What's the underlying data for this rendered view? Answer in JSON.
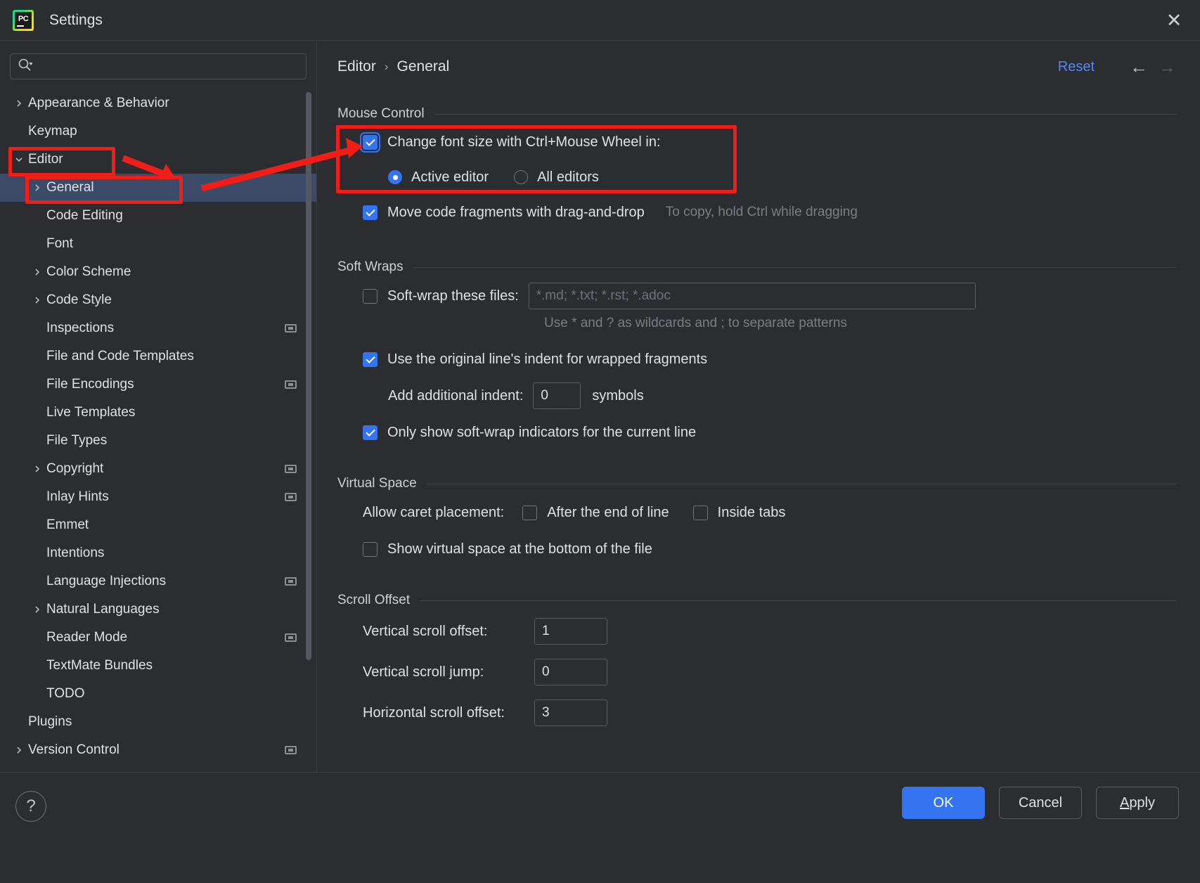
{
  "window": {
    "title": "Settings",
    "app_icon": "pycharm-icon",
    "close_icon": "close-icon"
  },
  "sidebar": {
    "search": {
      "placeholder": "",
      "value": "",
      "icon": "search-icon"
    },
    "items": [
      {
        "label": "Appearance & Behavior",
        "arrow": "chevron-right",
        "indent": 0,
        "selected": false,
        "badge": false
      },
      {
        "label": "Keymap",
        "arrow": "none",
        "indent": 0,
        "selected": false,
        "badge": false
      },
      {
        "label": "Editor",
        "arrow": "chevron-down",
        "indent": 0,
        "selected": false,
        "badge": false
      },
      {
        "label": "General",
        "arrow": "chevron-right",
        "indent": 1,
        "selected": true,
        "badge": false
      },
      {
        "label": "Code Editing",
        "arrow": "none",
        "indent": 1,
        "selected": false,
        "badge": false
      },
      {
        "label": "Font",
        "arrow": "none",
        "indent": 1,
        "selected": false,
        "badge": false
      },
      {
        "label": "Color Scheme",
        "arrow": "chevron-right",
        "indent": 1,
        "selected": false,
        "badge": false
      },
      {
        "label": "Code Style",
        "arrow": "chevron-right",
        "indent": 1,
        "selected": false,
        "badge": false
      },
      {
        "label": "Inspections",
        "arrow": "none",
        "indent": 1,
        "selected": false,
        "badge": true
      },
      {
        "label": "File and Code Templates",
        "arrow": "none",
        "indent": 1,
        "selected": false,
        "badge": false
      },
      {
        "label": "File Encodings",
        "arrow": "none",
        "indent": 1,
        "selected": false,
        "badge": true
      },
      {
        "label": "Live Templates",
        "arrow": "none",
        "indent": 1,
        "selected": false,
        "badge": false
      },
      {
        "label": "File Types",
        "arrow": "none",
        "indent": 1,
        "selected": false,
        "badge": false
      },
      {
        "label": "Copyright",
        "arrow": "chevron-right",
        "indent": 1,
        "selected": false,
        "badge": true
      },
      {
        "label": "Inlay Hints",
        "arrow": "none",
        "indent": 1,
        "selected": false,
        "badge": true
      },
      {
        "label": "Emmet",
        "arrow": "none",
        "indent": 1,
        "selected": false,
        "badge": false
      },
      {
        "label": "Intentions",
        "arrow": "none",
        "indent": 1,
        "selected": false,
        "badge": false
      },
      {
        "label": "Language Injections",
        "arrow": "none",
        "indent": 1,
        "selected": false,
        "badge": true
      },
      {
        "label": "Natural Languages",
        "arrow": "chevron-right",
        "indent": 1,
        "selected": false,
        "badge": false
      },
      {
        "label": "Reader Mode",
        "arrow": "none",
        "indent": 1,
        "selected": false,
        "badge": true
      },
      {
        "label": "TextMate Bundles",
        "arrow": "none",
        "indent": 1,
        "selected": false,
        "badge": false
      },
      {
        "label": "TODO",
        "arrow": "none",
        "indent": 1,
        "selected": false,
        "badge": false
      },
      {
        "label": "Plugins",
        "arrow": "none",
        "indent": 0,
        "selected": false,
        "badge": false
      },
      {
        "label": "Version Control",
        "arrow": "chevron-right",
        "indent": 0,
        "selected": false,
        "badge": true
      }
    ]
  },
  "header": {
    "breadcrumb": [
      "Editor",
      "General"
    ],
    "separator": "›",
    "reset_label": "Reset",
    "back_icon": "arrow-left-icon",
    "forward_icon": "arrow-right-icon"
  },
  "sections": {
    "mouse_control": {
      "title": "Mouse Control",
      "change_font_size": {
        "label": "Change font size with Ctrl+Mouse Wheel in:",
        "checked": true
      },
      "scope_options": [
        {
          "label": "Active editor",
          "selected": true
        },
        {
          "label": "All editors",
          "selected": false
        }
      ],
      "drag_and_drop": {
        "label": "Move code fragments with drag-and-drop",
        "checked": true,
        "hint": "To copy, hold Ctrl while dragging"
      }
    },
    "soft_wraps": {
      "title": "Soft Wraps",
      "soft_wrap_files": {
        "label": "Soft-wrap these files:",
        "checked": false,
        "value": "",
        "placeholder": "*.md; *.txt; *.rst; *.adoc"
      },
      "wildcard_hint": "Use * and ? as wildcards and ; to separate patterns",
      "original_indent": {
        "label": "Use the original line's indent for wrapped fragments",
        "checked": true
      },
      "additional_indent": {
        "label": "Add additional indent:",
        "value": "0",
        "units": "symbols"
      },
      "only_current_line": {
        "label": "Only show soft-wrap indicators for the current line",
        "checked": true
      }
    },
    "virtual_space": {
      "title": "Virtual Space",
      "caret_placement_label": "Allow caret placement:",
      "caret_options": [
        {
          "label": "After the end of line",
          "checked": false
        },
        {
          "label": "Inside tabs",
          "checked": false
        }
      ],
      "show_virtual_space": {
        "label": "Show virtual space at the bottom of the file",
        "checked": false
      }
    },
    "scroll_offset": {
      "title": "Scroll Offset",
      "fields": [
        {
          "label": "Vertical scroll offset:",
          "value": "1"
        },
        {
          "label": "Vertical scroll jump:",
          "value": "0"
        },
        {
          "label": "Horizontal scroll offset:",
          "value": "3"
        }
      ]
    }
  },
  "footer": {
    "help_label": "?",
    "ok_label": "OK",
    "cancel_label": "Cancel",
    "apply_label_prefix": "A",
    "apply_label_rest": "pply"
  },
  "colors": {
    "accent": "#3574f0",
    "link": "#548af7",
    "selection": "#3b4a66",
    "annotation": "#f01e18",
    "background": "#2b2d30"
  }
}
